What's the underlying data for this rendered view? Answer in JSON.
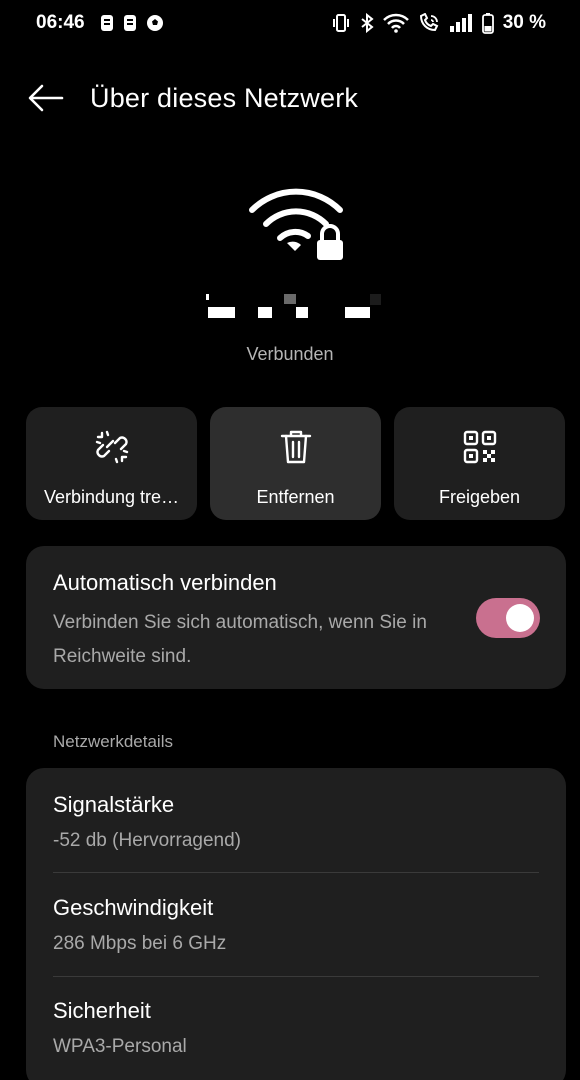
{
  "status_bar": {
    "time": "06:46",
    "battery": "30 %",
    "left_icons": [
      "sim-notification-icon",
      "sim-notification-icon",
      "football-icon"
    ],
    "right_icons": [
      "vibrate-icon",
      "bluetooth-icon",
      "wifi-icon",
      "wifi-calling-icon",
      "signal-icon",
      "battery-icon"
    ]
  },
  "header": {
    "title": "Über dieses Netzwerk"
  },
  "network": {
    "status": "Verbunden"
  },
  "actions": [
    {
      "label": "Verbindung tre…",
      "icon": "unlink-icon"
    },
    {
      "label": "Entfernen",
      "icon": "trash-icon"
    },
    {
      "label": "Freigeben",
      "icon": "qr-code-icon"
    }
  ],
  "auto_connect": {
    "title": "Automatisch verbinden",
    "description": "Verbinden Sie sich automatisch, wenn Sie in Reichweite sind.",
    "enabled": true
  },
  "details": {
    "section_label": "Netzwerkdetails",
    "items": [
      {
        "title": "Signalstärke",
        "value": "-52 db (Hervorragend)"
      },
      {
        "title": "Geschwindigkeit",
        "value": "286 Mbps bei 6 GHz"
      },
      {
        "title": "Sicherheit",
        "value": "WPA3-Personal"
      }
    ]
  },
  "colors": {
    "background": "#000000",
    "card": "#1f1f1f",
    "card_active": "#2e2e2e",
    "toggle_on": "#c9708f",
    "secondary_text": "#a9a9a9"
  }
}
